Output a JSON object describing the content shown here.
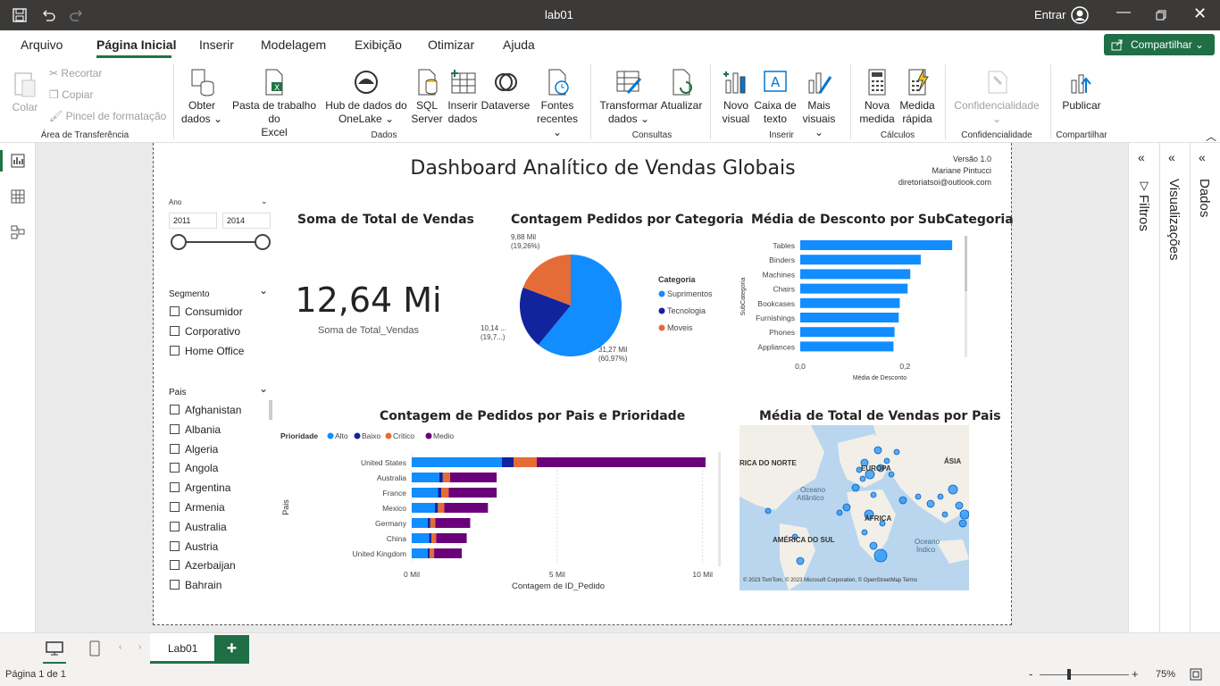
{
  "window": {
    "title": "lab01",
    "signin": "Entrar"
  },
  "menu": {
    "items": [
      "Arquivo",
      "Página Inicial",
      "Inserir",
      "Modelagem",
      "Exibição",
      "Otimizar",
      "Ajuda"
    ],
    "share": "Compartilhar"
  },
  "ribbon": {
    "clipboard": {
      "paste": "Colar",
      "cut": "Recortar",
      "copy": "Copiar",
      "format": "Pincel de formatação",
      "group": "Área de Transferência"
    },
    "data": {
      "get": [
        "Obter",
        "dados"
      ],
      "excel": [
        "Pasta de trabalho do",
        "Excel"
      ],
      "onelake": [
        "Hub de dados do",
        "OneLake"
      ],
      "sql": [
        "SQL",
        "Server"
      ],
      "enter": [
        "Inserir",
        "dados"
      ],
      "dataverse": "Dataverse",
      "recent": [
        "Fontes",
        "recentes"
      ],
      "group": "Dados"
    },
    "queries": {
      "transform": [
        "Transformar",
        "dados"
      ],
      "refresh": "Atualizar",
      "group": "Consultas"
    },
    "insert": {
      "visual": [
        "Novo",
        "visual"
      ],
      "textbox": [
        "Caixa de",
        "texto"
      ],
      "more": [
        "Mais",
        "visuais"
      ],
      "group": "Inserir"
    },
    "calc": {
      "measure": [
        "Nova",
        "medida"
      ],
      "quick": [
        "Medida",
        "rápida"
      ],
      "group": "Cálculos"
    },
    "sensitivity": {
      "label": "Confidencialidade",
      "group": "Confidencialidade"
    },
    "share": {
      "publish": "Publicar",
      "group": "Compartilhar"
    }
  },
  "report": {
    "title": "Dashboard Analítico de Vendas Globais",
    "meta": [
      "Versão 1.0",
      "Mariane Pintucci",
      "diretoriatsoi@outlook.com"
    ],
    "year_slicer": {
      "label": "Ano",
      "from": "2011",
      "to": "2014"
    },
    "segment_slicer": {
      "label": "Segmento",
      "items": [
        "Consumidor",
        "Corporativo",
        "Home Office"
      ]
    },
    "country_slicer": {
      "label": "Pais",
      "items": [
        "Afghanistan",
        "Albania",
        "Algeria",
        "Angola",
        "Argentina",
        "Armenia",
        "Australia",
        "Austria",
        "Azerbaijan",
        "Bahrain"
      ]
    },
    "card": {
      "title": "Soma de Total de Vendas",
      "value": "12,64 Mi",
      "caption": "Soma de Total_Vendas"
    },
    "pie": {
      "title": "Contagem Pedidos por Categoria",
      "legend_title": "Categoria"
    },
    "bar": {
      "title": "Média de Desconto por SubCategoria",
      "ylabel": "SubCategoria",
      "xlabel": "Média de Desconto",
      "ticks": [
        "0,0",
        "0,2"
      ]
    },
    "stacked": {
      "title": "Contagem de Pedidos por Pais e Prioridade",
      "legend_title": "Prioridade",
      "ylabel": "Pais",
      "xlabel": "Contagem de ID_Pedido",
      "ticks": [
        "0 Mil",
        "5 Mil",
        "10 Mil"
      ]
    },
    "map": {
      "title": "Média de Total de Vendas por Pais",
      "labels": [
        "RICA DO NORTE",
        "EUROPA",
        "ÁSIA",
        "Oceano",
        "Atlântico",
        "ÁFRICA",
        "AMÉRICA DO SUL",
        "Oceano",
        "Índico"
      ],
      "credit": "© 2023 TomTom, © 2023 Microsoft Corporation, © OpenStreetMap  Terms"
    }
  },
  "panes": {
    "filters": "Filtros",
    "visualizations": "Visualizações",
    "data": "Dados"
  },
  "tabs": {
    "page": "Lab01",
    "add": "+"
  },
  "status": {
    "page": "Página 1 de 1",
    "zoom": "75%"
  },
  "chart_data": [
    {
      "type": "pie",
      "title": "Contagem Pedidos por Categoria",
      "legend": "Categoria",
      "series": [
        {
          "name": "Suprimentos",
          "value": 31.27,
          "label": "31,27 Mil",
          "pct": "(60,97%)",
          "color": "#118dff"
        },
        {
          "name": "Tecnologia",
          "value": 10.14,
          "label": "10,14 ...",
          "pct": "(19,7...)",
          "color": "#12239e"
        },
        {
          "name": "Moveis",
          "value": 9.88,
          "label": "9,88 Mil",
          "pct": "(19,26%)",
          "color": "#e66c37"
        }
      ]
    },
    {
      "type": "bar",
      "title": "Média de Desconto por SubCategoria",
      "categories": [
        "Tables",
        "Binders",
        "Machines",
        "Chairs",
        "Bookcases",
        "Furnishings",
        "Phones",
        "Appliances"
      ],
      "values": [
        0.29,
        0.23,
        0.21,
        0.205,
        0.19,
        0.188,
        0.18,
        0.178
      ],
      "xlim": [
        0,
        0.3
      ],
      "color": "#118dff"
    },
    {
      "type": "bar",
      "stacked": true,
      "title": "Contagem de Pedidos por Pais e Prioridade",
      "categories": [
        "United States",
        "Australia",
        "France",
        "Mexico",
        "Germany",
        "China",
        "United Kingdom"
      ],
      "xlim": [
        0,
        10.5
      ],
      "series": [
        {
          "name": "Alto",
          "color": "#118dff",
          "values": [
            3.1,
            0.95,
            0.9,
            0.8,
            0.55,
            0.6,
            0.55
          ]
        },
        {
          "name": "Baixo",
          "color": "#12239e",
          "values": [
            0.4,
            0.12,
            0.12,
            0.1,
            0.09,
            0.08,
            0.07
          ]
        },
        {
          "name": "Critico",
          "color": "#e66c37",
          "values": [
            0.8,
            0.25,
            0.25,
            0.22,
            0.17,
            0.16,
            0.15
          ]
        },
        {
          "name": "Medio",
          "color": "#6b007b",
          "values": [
            5.8,
            1.6,
            1.65,
            1.5,
            1.2,
            1.05,
            0.95
          ]
        }
      ]
    }
  ]
}
